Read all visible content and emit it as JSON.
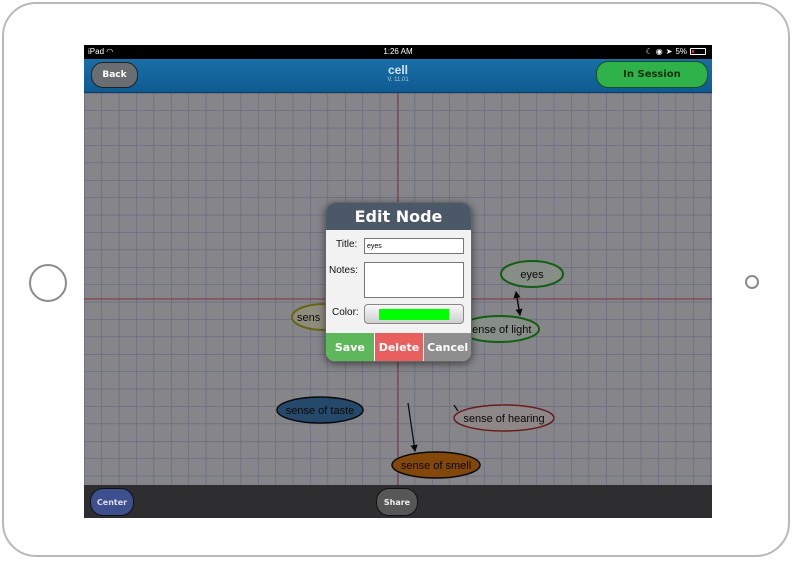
{
  "status_bar": {
    "device": "iPad",
    "time": "1:26 AM",
    "battery": "5%"
  },
  "nav": {
    "back_label": "Back",
    "title": "cell",
    "version": "V. 11.01",
    "session_label": "In Session"
  },
  "nodes": {
    "eyes": "eyes",
    "light": "sense of light",
    "partial_left": "sens",
    "taste": "sense of taste",
    "hearing": "sense of hearing",
    "smell": "sense of smell"
  },
  "dialog": {
    "heading": "Edit Node",
    "title_label": "Title:",
    "title_value": "eyes",
    "notes_label": "Notes:",
    "notes_value": "",
    "color_label": "Color:",
    "color_value": "#00ff00",
    "save_label": "Save",
    "delete_label": "Delete",
    "cancel_label": "Cancel"
  },
  "bottom": {
    "center_label": "Center",
    "share_label": "Share"
  },
  "colors": {
    "nav": "#1a6fa8",
    "session_button": "#2fb24a",
    "dialog_header": "#4b5868",
    "save": "#5cb85a",
    "delete": "#e85f5d",
    "cancel": "#8e8e8e"
  }
}
